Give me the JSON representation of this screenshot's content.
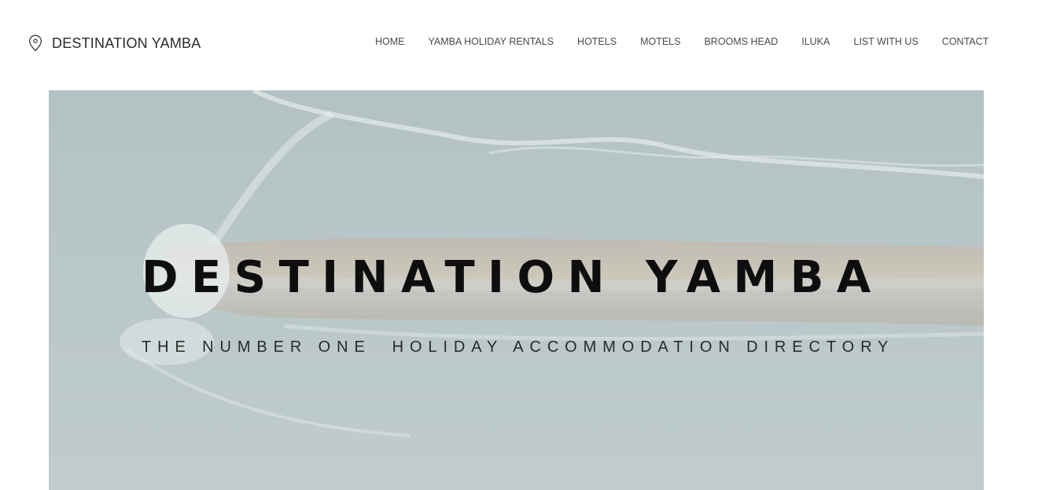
{
  "brand": {
    "name": "DESTINATION YAMBA",
    "icon": "map-pin-icon"
  },
  "nav": {
    "items": [
      {
        "label": "HOME"
      },
      {
        "label": "YAMBA HOLIDAY RENTALS"
      },
      {
        "label": "HOTELS"
      },
      {
        "label": "MOTELS"
      },
      {
        "label": "BROOMS HEAD"
      },
      {
        "label": "ILUKA"
      },
      {
        "label": "LIST WITH US"
      },
      {
        "label": "CONTACT"
      }
    ]
  },
  "hero": {
    "title": "DESTINATION YAMBA",
    "subtitle": "THE NUMBER ONE  HOLIDAY ACCOMMODATION DIRECTORY",
    "background": "aerial-breakwater-ocean-image"
  },
  "colors": {
    "text_dark": "#0e0e0e",
    "nav_text": "#4a4a4a",
    "hero_overlay": "#e8eeee",
    "ocean": "#8fa3a6"
  }
}
